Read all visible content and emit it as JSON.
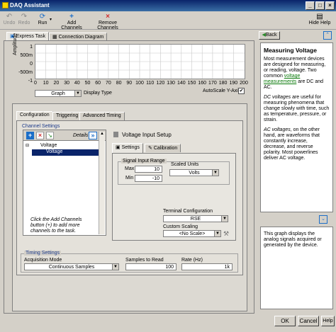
{
  "window": {
    "title": "DAQ Assistant",
    "minimize": "_",
    "maximize": "□",
    "close": "×"
  },
  "toolbar": {
    "undo": "Undo",
    "redo": "Redo",
    "run": "Run",
    "add_channels": "Add Channels",
    "remove_channels": "Remove Channels",
    "hide_help": "Hide Help"
  },
  "view_tabs": {
    "express_task": "Express Task",
    "connection_diagram": "Connection Diagram"
  },
  "graph": {
    "ylabel": "Amplitude",
    "y_ticks": [
      "1",
      "500m",
      "0",
      "-500m",
      "-1"
    ],
    "x_ticks": [
      "0",
      "10",
      "20",
      "30",
      "40",
      "50",
      "60",
      "70",
      "80",
      "90",
      "100",
      "110",
      "120",
      "130",
      "140",
      "150",
      "160",
      "170",
      "180",
      "190",
      "200"
    ],
    "display_type_value": "Graph",
    "display_type_label": "Display Type",
    "autoscale_label": "AutoScale Y-Axis",
    "autoscale_checked": "✔"
  },
  "config_tabs": {
    "configuration": "Configuration",
    "triggering": "Triggering",
    "advanced_timing": "Advanced Timing"
  },
  "channel_settings": {
    "label": "Channel Settings",
    "details": "Details",
    "expand": "»",
    "tree_root": "Voltage",
    "tree_child": "Voltage",
    "hint": "Click the Add Channels button (+) to add more channels to the task."
  },
  "voltage_setup": {
    "title": "Voltage Input Setup",
    "tab_settings": "Settings",
    "tab_calibration": "Calibration",
    "signal_range_label": "Signal Input Range",
    "max_label": "Max",
    "max_value": "10",
    "min_label": "Min",
    "min_value": "-10",
    "scaled_units_label": "Scaled Units",
    "scaled_units_value": "Volts",
    "terminal_config_label": "Terminal Configuration",
    "terminal_config_value": "RSE",
    "custom_scaling_label": "Custom Scaling",
    "custom_scaling_value": "<No Scale>"
  },
  "timing": {
    "label": "Timing Settings",
    "acq_mode_label": "Acquisition Mode",
    "acq_mode_value": "Continuous Samples",
    "samples_label": "Samples to Read",
    "samples_value": "100",
    "rate_label": "Rate (Hz)",
    "rate_value": "1k"
  },
  "help": {
    "back": "Back",
    "title": "Measuring Voltage",
    "p1_pre": "Most measurement devices are designed for measuring, or reading, voltage. Two common ",
    "p1_link": "voltage measurements",
    "p1_post": " are DC and AC.",
    "p2_em": "DC voltages",
    "p2_rest": " are useful for measuring phenomena that change slowly with time, such as temperature, pressure, or strain.",
    "p3_em": "AC voltages",
    "p3_rest": ", on the other hand, are waveforms that constantly increase, decrease, and reverse polarity. Most powerlines deliver AC voltage.",
    "p4": "This graph displays the analog signals acquired or generated by the device."
  },
  "buttons": {
    "ok": "OK",
    "cancel": "Cancel",
    "help": "Help"
  }
}
